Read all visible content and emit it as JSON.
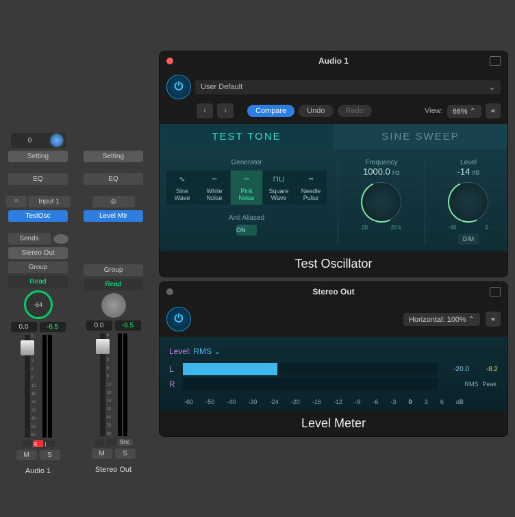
{
  "strips": [
    {
      "name": "Audio 1",
      "pan": "0",
      "setting": "Setting",
      "eq": "EQ",
      "input_toggle": "○",
      "input": "Input 1",
      "insert": "TestOsc",
      "sends": "Sends",
      "output": "Stereo Out",
      "group": "Group",
      "automation": "Read",
      "knob_val": "-64",
      "val_l": "0.0",
      "val_r": "-6.5",
      "rec": "R",
      "inp": "I",
      "m": "M",
      "s": "S"
    },
    {
      "name": "Stereo Out",
      "setting": "Setting",
      "eq": "EQ",
      "stereo_icon": "◎",
      "insert": "Level Mtr",
      "group": "Group",
      "automation": "Read",
      "val_l": "0.0",
      "val_r": "-6.5",
      "bnc": "Bnc",
      "m": "M",
      "s": "S"
    }
  ],
  "osc": {
    "window_title": "Audio 1",
    "preset": "User Default",
    "nav_prev": "‹",
    "nav_next": "›",
    "compare": "Compare",
    "undo": "Undo",
    "redo": "Redo",
    "view": "View:",
    "zoom": "66%",
    "tabs": [
      "TEST TONE",
      "SINE SWEEP"
    ],
    "generator_label": "Generator",
    "gens": [
      {
        "l1": "Sine",
        "l2": "Wave",
        "icon": "∿"
      },
      {
        "l1": "White",
        "l2": "Noise",
        "icon": "┉"
      },
      {
        "l1": "Pink",
        "l2": "Noise",
        "icon": "┉",
        "sel": true
      },
      {
        "l1": "Square",
        "l2": "Wave",
        "icon": "⊓⊔"
      },
      {
        "l1": "Needle",
        "l2": "Pulse",
        "icon": "┅"
      }
    ],
    "aa_label": "Anti Aliased",
    "aa_on": "ON",
    "freq_label": "Frequency",
    "freq_val": "1000.0",
    "freq_unit": "Hz",
    "freq_lo": "20",
    "freq_hi": "20 k",
    "level_label": "Level",
    "level_val": "-14",
    "level_unit": "dB",
    "level_lo": "-96",
    "level_hi": "6",
    "dim": "DIM",
    "name": "Test Oscillator"
  },
  "lm": {
    "window_title": "Stereo Out",
    "horiz": "Horizontal: 100%",
    "level_label": "Level:",
    "mode": "RMS",
    "L": "L",
    "R": "R",
    "rms_val": "-20.0",
    "peak_val": "-8.2",
    "rms_lbl": "RMS",
    "peak_lbl": "Peak",
    "scale": [
      "-60",
      "-50",
      "-40",
      "-30",
      "-24",
      "-20",
      "-16",
      "-12",
      "-9",
      "-6",
      "-3",
      "0",
      "3",
      "6",
      "dB"
    ],
    "name": "Level Meter"
  },
  "ruler": [
    "6",
    "3",
    "0",
    "3",
    "6",
    "9",
    "12",
    "18",
    "24",
    "32",
    "40",
    "50",
    "60"
  ]
}
